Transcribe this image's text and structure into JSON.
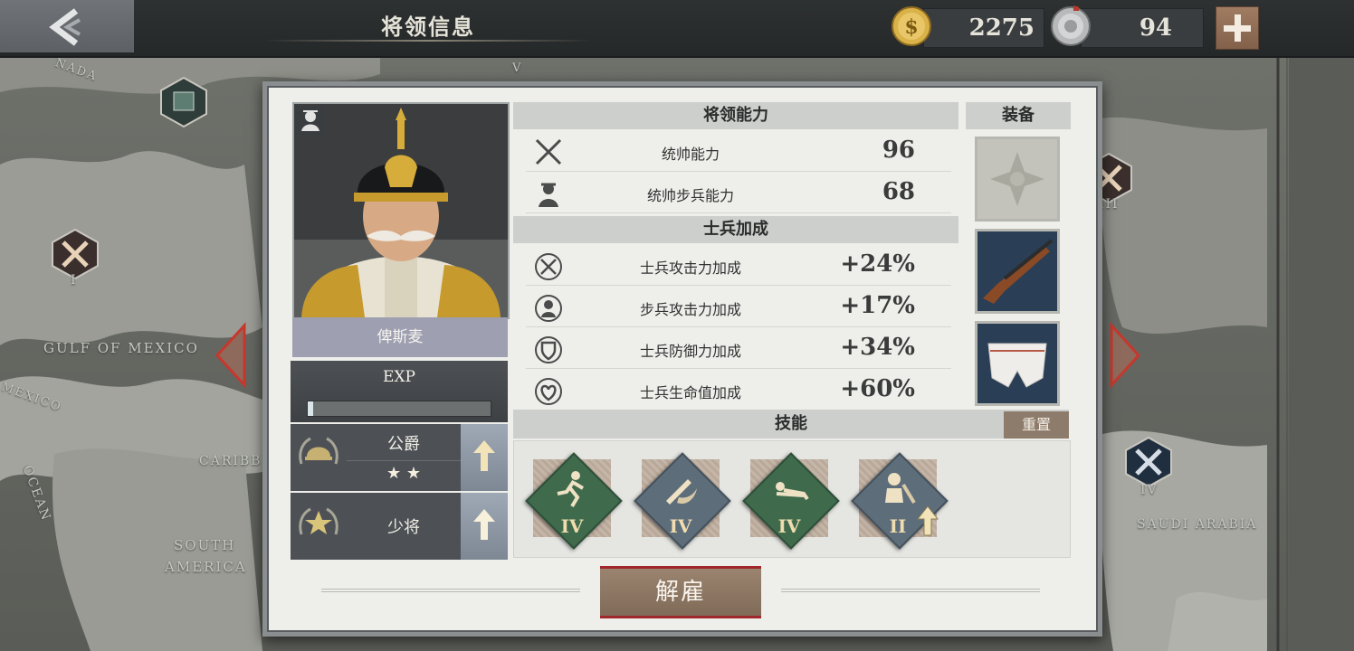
{
  "header": {
    "title": "将领信息",
    "gold": "2275",
    "medals": "94"
  },
  "map_labels": {
    "gulf": "GULF OF MEXICO",
    "mexico": "MEXICO",
    "south_america_1": "SOUTH",
    "south_america_2": "AMERICA",
    "caribbean": "CARIBB",
    "ocean": "OCEAN",
    "saudi": "SAUDI ARABIA",
    "canada": "NADA",
    "unit_I": "I",
    "unit_III": "III",
    "unit_IV": "IV",
    "unit_V": "V"
  },
  "general": {
    "name": "俾斯麦",
    "exp_label": "EXP",
    "exp_progress": 0.03,
    "title_rank": "公爵",
    "title_stars": "★ ★",
    "military_rank": "少将"
  },
  "abilities": {
    "heading": "将领能力",
    "rows": [
      {
        "label": "统帅能力",
        "value": "96"
      },
      {
        "label": "统帅步兵能力",
        "value": "68"
      }
    ]
  },
  "bonuses": {
    "heading": "士兵加成",
    "rows": [
      {
        "label": "士兵攻击力加成",
        "value": "+24%"
      },
      {
        "label": "步兵攻击力加成",
        "value": "+17%"
      },
      {
        "label": "士兵防御力加成",
        "value": "+34%"
      },
      {
        "label": "士兵生命值加成",
        "value": "+60%"
      }
    ]
  },
  "equipment": {
    "heading": "装备"
  },
  "skills": {
    "heading": "技能",
    "reset_label": "重置",
    "items": [
      {
        "level": "IV",
        "color": "#3f6b4c"
      },
      {
        "level": "IV",
        "color": "#5d6d7a"
      },
      {
        "level": "IV",
        "color": "#3f6b4c"
      },
      {
        "level": "II",
        "color": "#5d6d7a"
      }
    ]
  },
  "actions": {
    "dismiss_label": "解雇"
  },
  "colors": {
    "accent_red": "#a0272a",
    "panel_bg": "#eeeeea",
    "button_brown": "#8d7c6c"
  }
}
